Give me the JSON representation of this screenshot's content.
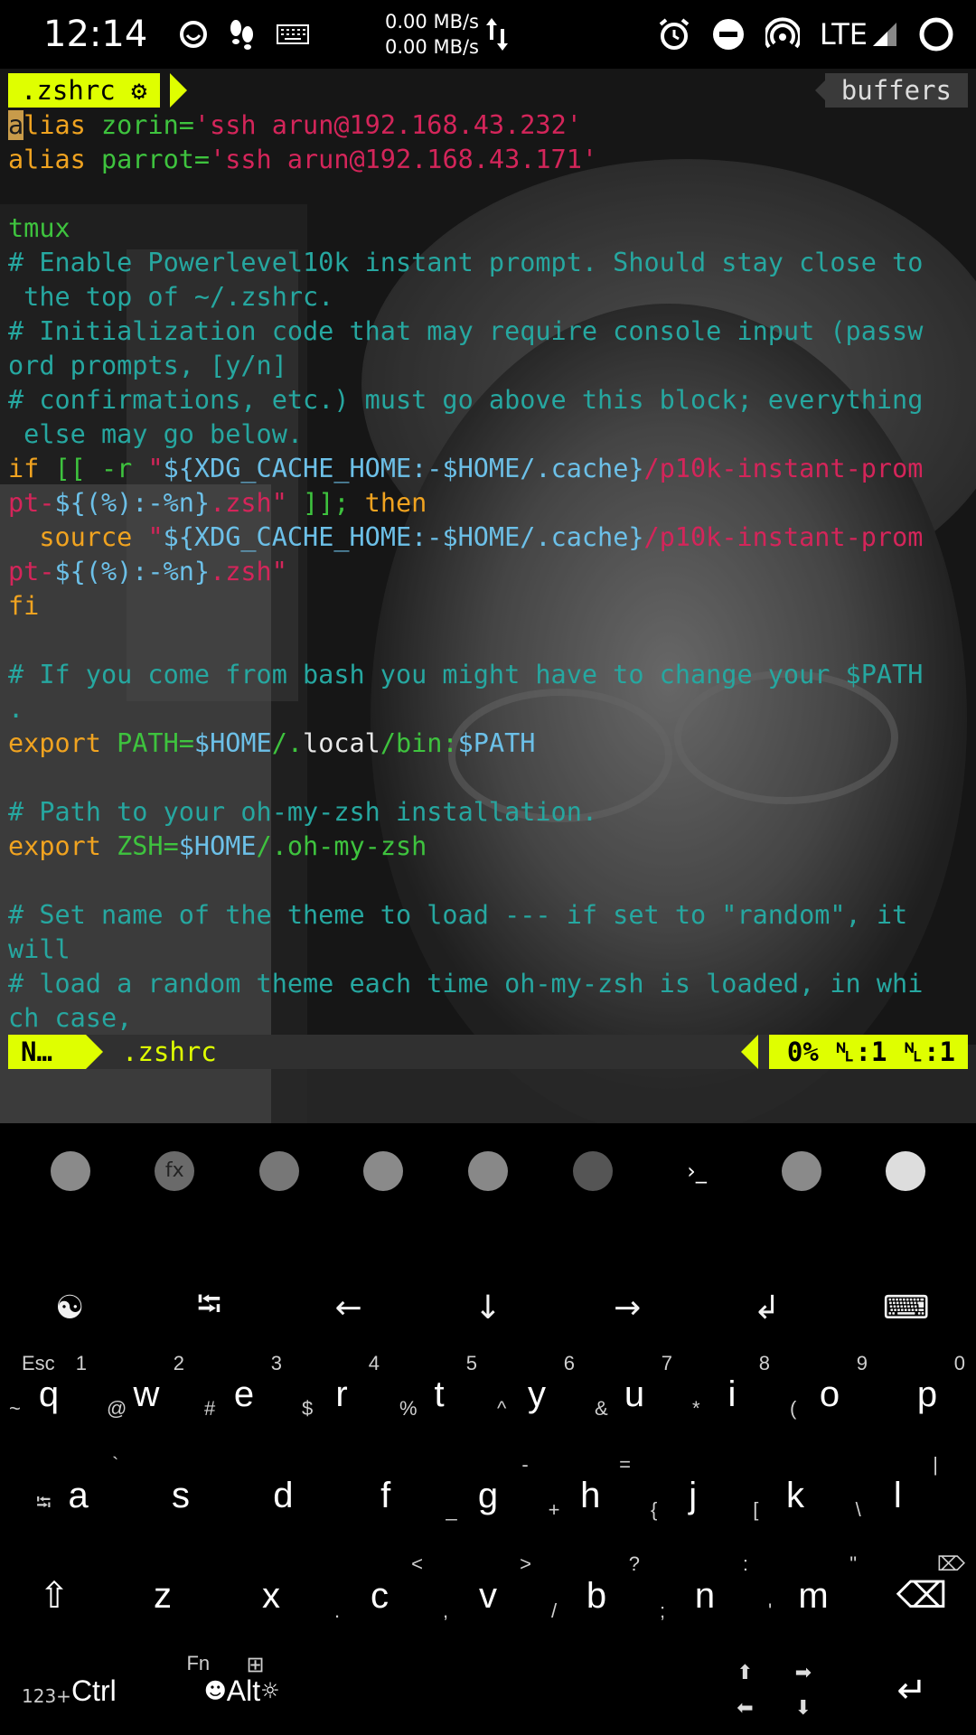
{
  "status_bar": {
    "time": "12:14",
    "speed_up": "0.00 MB/s",
    "speed_down": "0.00 MB/s",
    "network": "LTE",
    "icons": [
      "smiley-icon",
      "footsteps-icon",
      "keyboard-icon",
      "alarm-icon",
      "dnd-icon",
      "hotspot-icon",
      "signal-icon",
      "circle-icon"
    ]
  },
  "vim": {
    "tab_active": ".zshrc ⚙",
    "tab_buffers": "buffers",
    "mode": "N…",
    "filename": ".zshrc",
    "position": "0% ␤:1 ␤:1",
    "lines": [
      [
        [
          "cursor",
          "a"
        ],
        [
          "kw",
          "lias "
        ],
        [
          "grn",
          "zorin="
        ],
        [
          "str",
          "'ssh arun@192.168.43.232'"
        ]
      ],
      [
        [
          "kw",
          "alias "
        ],
        [
          "grn",
          "parrot="
        ],
        [
          "str",
          "'ssh arun@192.168.43.171'"
        ]
      ],
      [],
      [
        [
          "grn",
          "tmux"
        ]
      ],
      [
        [
          "cmt",
          "# Enable Powerlevel10k instant prompt. Should stay close to"
        ]
      ],
      [
        [
          "cmt",
          " the top of ~/.zshrc."
        ]
      ],
      [
        [
          "cmt",
          "# Initialization code that may require console input (passw"
        ]
      ],
      [
        [
          "cmt",
          "ord prompts, [y/n]"
        ]
      ],
      [
        [
          "cmt",
          "# confirmations, etc.) must go above this block; everything"
        ]
      ],
      [
        [
          "cmt",
          " else may go below."
        ]
      ],
      [
        [
          "kw",
          "if "
        ],
        [
          "grn",
          "[[ -r "
        ],
        [
          "str",
          "\""
        ],
        [
          "var",
          "${XDG_CACHE_HOME:-$HOME/.cache}"
        ],
        [
          "str",
          "/p10k-instant-prom"
        ]
      ],
      [
        [
          "str",
          "pt-"
        ],
        [
          "var",
          "${(%):-%n}"
        ],
        [
          "str",
          ".zsh\" "
        ],
        [
          "grn",
          "]]; "
        ],
        [
          "kw",
          "then"
        ]
      ],
      [
        [
          "kw",
          "  source "
        ],
        [
          "str",
          "\""
        ],
        [
          "var",
          "${XDG_CACHE_HOME:-$HOME/.cache}"
        ],
        [
          "str",
          "/p10k-instant-prom"
        ]
      ],
      [
        [
          "str",
          "pt-"
        ],
        [
          "var",
          "${(%):-%n}"
        ],
        [
          "str",
          ".zsh\""
        ]
      ],
      [
        [
          "kw",
          "fi"
        ]
      ],
      [],
      [
        [
          "cmt",
          "# If you come from bash you might have to change your $PATH"
        ]
      ],
      [
        [
          "cmt",
          "."
        ]
      ],
      [
        [
          "kw",
          "export "
        ],
        [
          "grn",
          "PATH="
        ],
        [
          "var",
          "$HOME"
        ],
        [
          "grn",
          "/."
        ],
        [
          "wht",
          "local"
        ],
        [
          "grn",
          "/bin:"
        ],
        [
          "var",
          "$PATH"
        ]
      ],
      [],
      [
        [
          "cmt",
          "# Path to your oh-my-zsh installation."
        ]
      ],
      [
        [
          "kw",
          "export "
        ],
        [
          "grn",
          "ZSH="
        ],
        [
          "var",
          "$HOME"
        ],
        [
          "grn",
          "/.oh-my-zsh"
        ]
      ],
      [],
      [
        [
          "cmt",
          "# Set name of the theme to load --- if set to \"random\", it"
        ]
      ],
      [
        [
          "cmt",
          "will"
        ]
      ],
      [
        [
          "cmt",
          "# load a random theme each time oh-my-zsh is loaded, in whi"
        ]
      ],
      [
        [
          "cmt",
          "ch case,"
        ]
      ]
    ]
  },
  "dock": {
    "apps": [
      "phone-icon",
      "fx-file-manager-icon",
      "app-icon",
      "chrome-icon",
      "music-icon",
      "spotify-icon",
      "terminal-icon",
      "settings-icon",
      "camera-icon"
    ],
    "labels": [
      "",
      "fx",
      "",
      "",
      "",
      "",
      "›_",
      "",
      ""
    ]
  },
  "keyboard": {
    "extra_keys": [
      "☯",
      "⭾",
      "←",
      "↓",
      "→",
      "↲",
      "⌨"
    ],
    "row1": [
      {
        "main": "q",
        "num": "1",
        "left": "~",
        "top": "Esc"
      },
      {
        "main": "w",
        "num": "2",
        "left": "@",
        "top": ""
      },
      {
        "main": "e",
        "num": "3",
        "left": "#",
        "top": ""
      },
      {
        "main": "r",
        "num": "4",
        "left": "$",
        "top": ""
      },
      {
        "main": "t",
        "num": "5",
        "left": "%",
        "top": ""
      },
      {
        "main": "y",
        "num": "6",
        "left": "^",
        "top": ""
      },
      {
        "main": "u",
        "num": "7",
        "left": "&",
        "top": ""
      },
      {
        "main": "i",
        "num": "8",
        "left": "*",
        "top": ""
      },
      {
        "main": "o",
        "num": "9",
        "left": "(",
        "top": ""
      },
      {
        "main": "p",
        "num": "0",
        "left": "",
        "top": ""
      }
    ],
    "row2": [
      {
        "main": "a",
        "num": "`",
        "left": "⭾",
        "top": ""
      },
      {
        "main": "s",
        "num": "",
        "left": "",
        "top": ""
      },
      {
        "main": "d",
        "num": "",
        "left": "",
        "top": ""
      },
      {
        "main": "f",
        "num": "",
        "left": "",
        "top": ""
      },
      {
        "main": "g",
        "num": "-",
        "left": "_",
        "top": ""
      },
      {
        "main": "h",
        "num": "=",
        "left": "+",
        "top": ""
      },
      {
        "main": "j",
        "num": "",
        "left": "{",
        "top": ""
      },
      {
        "main": "k",
        "num": "",
        "left": "[",
        "top": ""
      },
      {
        "main": "l",
        "num": "|",
        "left": "\\",
        "top": ""
      }
    ],
    "row3": [
      {
        "main": "⇧",
        "num": "",
        "left": "",
        "top": ""
      },
      {
        "main": "z",
        "num": "",
        "left": "",
        "top": ""
      },
      {
        "main": "x",
        "num": "",
        "left": "",
        "top": ""
      },
      {
        "main": "c",
        "num": "<",
        "left": ".",
        "top": ""
      },
      {
        "main": "v",
        "num": ">",
        "left": ",",
        "top": ""
      },
      {
        "main": "b",
        "num": "?",
        "left": "/",
        "top": ""
      },
      {
        "main": "n",
        "num": ":",
        "left": ";",
        "top": ""
      },
      {
        "main": "m",
        "num": "\"",
        "left": "'",
        "top": ""
      },
      {
        "main": "⌫",
        "num": "⌦",
        "left": "",
        "top": ""
      }
    ],
    "row4": {
      "ctrl": "Ctrl",
      "ctrl_prefix": "123+",
      "alt": "Alt",
      "fn": "Fn",
      "emoji": "☻",
      "brightness": "☼",
      "grid": "⊞",
      "arrows": [
        "⬆",
        "➡",
        "⬅",
        "⬇"
      ],
      "enter": "↵"
    }
  }
}
